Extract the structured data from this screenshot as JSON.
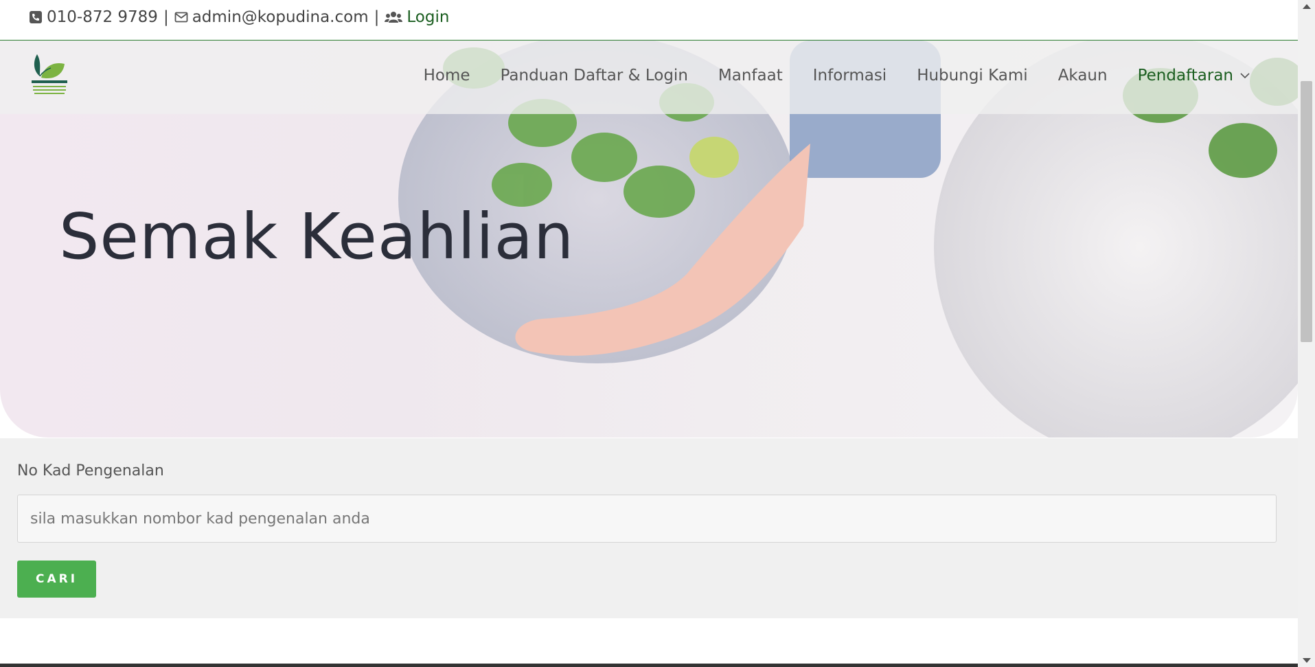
{
  "topbar": {
    "phone": "010-872 9789",
    "email": "admin@kopudina.com",
    "login": "Login",
    "separator": "|"
  },
  "brand": {
    "logo_text": "KOPUDINA",
    "logo_subtext": "KOPERASI PUJANGGA DINAMIK BERHAD",
    "accent": "#1b5e20"
  },
  "nav": {
    "items": [
      {
        "label": "Home"
      },
      {
        "label": "Panduan Daftar & Login"
      },
      {
        "label": "Manfaat"
      },
      {
        "label": "Informasi"
      },
      {
        "label": "Hubungi Kami"
      },
      {
        "label": "Akaun"
      },
      {
        "label": "Pendaftaran"
      }
    ]
  },
  "hero": {
    "title": "Semak Keahlian"
  },
  "form": {
    "label": "No Kad Pengenalan",
    "placeholder": "sila masukkan nombor kad pengenalan anda",
    "value": "",
    "button": "CARI",
    "button_color": "#4caf50"
  },
  "icons": {
    "phone": "phone-square-icon",
    "email": "envelope-icon",
    "login": "users-icon",
    "dropdown": "chevron-down-icon"
  }
}
